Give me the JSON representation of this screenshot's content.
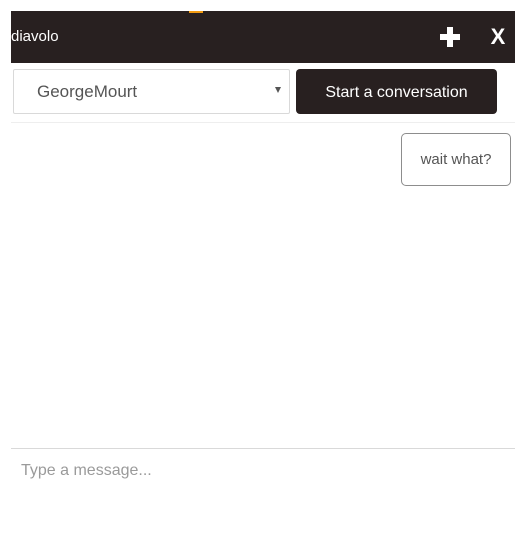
{
  "header": {
    "title": "diavolo",
    "add_icon": "plus-icon",
    "close_label": "X"
  },
  "toolbar": {
    "selected_user": "GeorgeMourt",
    "select_icon": "chevron-down-icon",
    "start_button_label": "Start a conversation"
  },
  "messages": [
    {
      "text": "wait what?"
    }
  ],
  "composer": {
    "placeholder": "Type a message..."
  },
  "colors": {
    "header_background": "#282020",
    "button_background": "#282020",
    "accent": "#f39c12",
    "text_primary": "#555555",
    "border": "#d9d9d9"
  }
}
